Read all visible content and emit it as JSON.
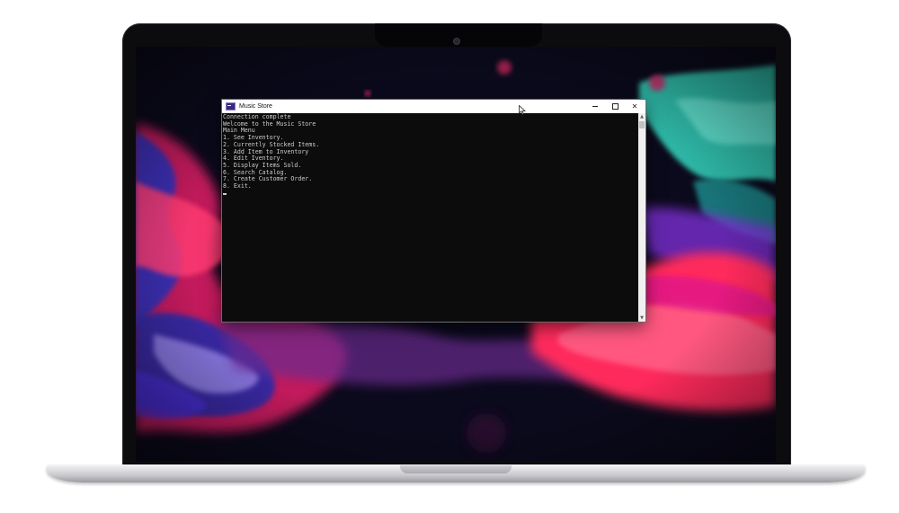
{
  "window": {
    "title": "Music Store",
    "icon": "console-app-icon",
    "controls": {
      "minimize_icon": "minimize-icon",
      "maximize_icon": "maximize-icon",
      "close_icon": "close-icon",
      "close_glyph": "✕"
    }
  },
  "console": {
    "lines": [
      "Connection complete",
      "Welcome to the Music Store",
      "Main Menu",
      "1. See Inventory.",
      "2. Currently Stocked Items.",
      "3. Add Item to Inventory",
      "4. Edit Iventory.",
      "5. Display Items Sold.",
      "6. Search Catalog.",
      "7. Create Customer Order.",
      "8. Exit."
    ],
    "text_color": "#cccccc",
    "background_color": "#0c0c0c"
  },
  "scrollbar": {
    "up_glyph": "▲",
    "down_glyph": "▼"
  },
  "wallpaper": {
    "colors": [
      "#0b0a1c",
      "#ff2d6f",
      "#3b2fb5",
      "#35c9b6",
      "#9b2ad6"
    ]
  }
}
